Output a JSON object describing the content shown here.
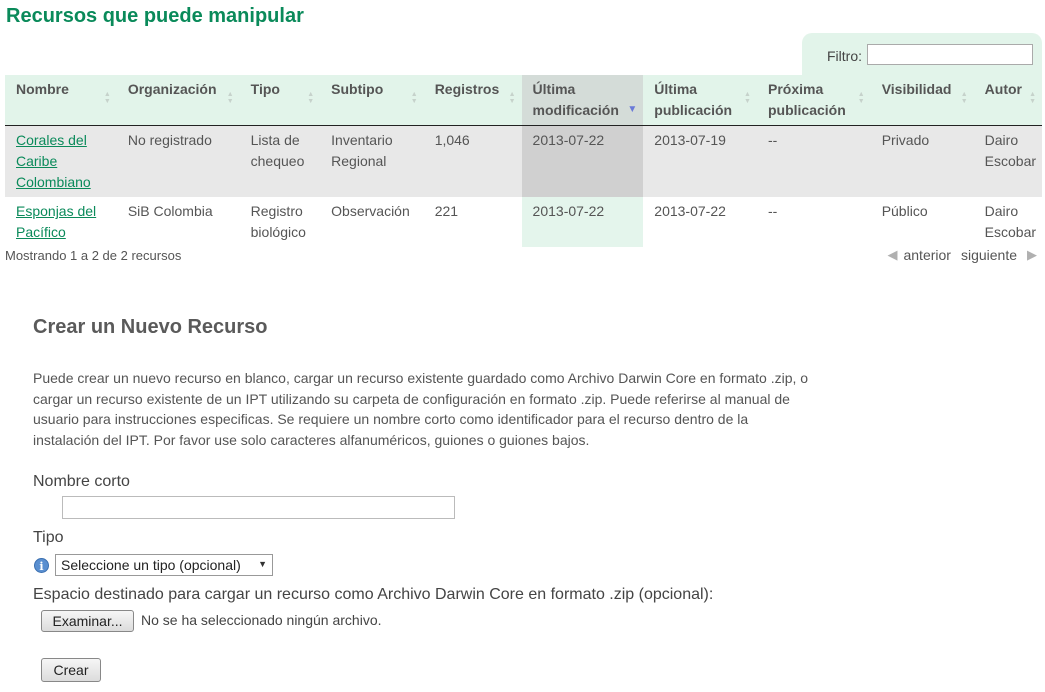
{
  "page_title": "Recursos que puede manipular",
  "filter": {
    "label": "Filtro:",
    "value": ""
  },
  "table": {
    "columns": [
      {
        "label": "Nombre",
        "sorted": false
      },
      {
        "label": "Organización",
        "sorted": false
      },
      {
        "label": "Tipo",
        "sorted": false
      },
      {
        "label": "Subtipo",
        "sorted": false
      },
      {
        "label": "Registros",
        "sorted": false
      },
      {
        "label": "Última modificación",
        "sorted": true
      },
      {
        "label": "Última publicación",
        "sorted": false
      },
      {
        "label": "Próxima publicación",
        "sorted": false
      },
      {
        "label": "Visibilidad",
        "sorted": false
      },
      {
        "label": "Autor",
        "sorted": false
      }
    ],
    "rows": [
      {
        "name": "Corales del Caribe Colombiano",
        "organization": "No registrado",
        "type": "Lista de chequeo",
        "subtype": "Inventario Regional",
        "records": "1,046",
        "last_modified": "2013-07-22",
        "last_published": "2013-07-19",
        "next_publication": "--",
        "visibility": "Privado",
        "author": "Dairo Escobar"
      },
      {
        "name": "Esponjas del Pacífico",
        "organization": "SiB Colombia",
        "type": "Registro biológico",
        "subtype": "Observación",
        "records": "221",
        "last_modified": "2013-07-22",
        "last_published": "2013-07-22",
        "next_publication": "--",
        "visibility": "Público",
        "author": "Dairo Escobar"
      }
    ],
    "info": "Mostrando 1 a 2 de 2 recursos",
    "pager": {
      "previous": "anterior",
      "next": "siguiente"
    }
  },
  "create": {
    "heading": "Crear un Nuevo Recurso",
    "description": "Puede crear un nuevo recurso en blanco, cargar un recurso existente guardado como Archivo Darwin Core en formato .zip, o cargar un recurso existente de un IPT utilizando su carpeta de configuración en formato .zip. Puede referirse al manual de usuario para instrucciones especificas. Se requiere un nombre corto como identificador para el recurso dentro de la instalación del IPT. Por favor use solo caracteres alfanuméricos, guiones o guiones bajos.",
    "short_name_label": "Nombre corto",
    "short_name_value": "",
    "type_label": "Tipo",
    "type_selected": "Seleccione un tipo (opcional)",
    "upload_label": "Espacio destinado para cargar un recurso como Archivo Darwin Core en formato .zip (opcional):",
    "browse_button": "Examinar...",
    "no_file_text": "No se ha seleccionado ningún archivo.",
    "create_button": "Crear"
  },
  "colors": {
    "title": "#0a8a5a",
    "header_bg": "#e2f4ea",
    "link": "#0a8a5a"
  }
}
